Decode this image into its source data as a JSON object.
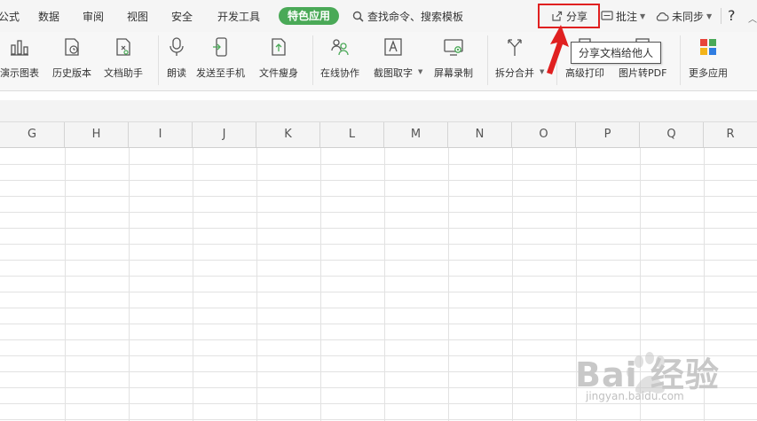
{
  "menu": {
    "items": [
      "公式",
      "数据",
      "审阅",
      "视图",
      "安全",
      "开发工具"
    ],
    "pill": "特色应用",
    "search": "查找命令、搜索模板",
    "share": "分享",
    "annotate": "批注",
    "sync": "未同步",
    "help": "?"
  },
  "ribbon": {
    "tools": [
      "演示图表",
      "历史版本",
      "文档助手",
      "朗读",
      "发送至手机",
      "文件瘦身",
      "在线协作",
      "截图取字",
      "屏幕录制",
      "拆分合并",
      "高级打印",
      "图片转PDF",
      "更多应用"
    ]
  },
  "tooltip": "分享文档给他人",
  "sheet": {
    "columns": [
      "G",
      "H",
      "I",
      "J",
      "K",
      "L",
      "M",
      "N",
      "O",
      "P",
      "Q",
      "R"
    ]
  },
  "watermark": {
    "text": "Bai 经验",
    "sub": "jingyan.baidu.com"
  },
  "colors": {
    "accent": "#4aa957",
    "highlight": "#e02020"
  }
}
